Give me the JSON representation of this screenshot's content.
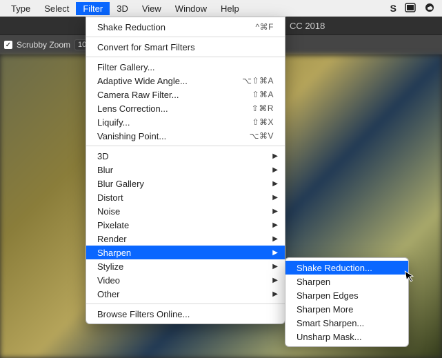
{
  "menubar": {
    "items": [
      "Type",
      "Select",
      "Filter",
      "3D",
      "View",
      "Window",
      "Help"
    ],
    "active_index": 2
  },
  "titlebar": {
    "app_suffix": "CC 2018"
  },
  "toolbar": {
    "scrubby_label": "Scrubby Zoom",
    "zoom_value": "10"
  },
  "dropdown": {
    "sections": [
      [
        {
          "label": "Shake Reduction",
          "shortcut": "^⌘F"
        }
      ],
      [
        {
          "label": "Convert for Smart Filters"
        }
      ],
      [
        {
          "label": "Filter Gallery..."
        },
        {
          "label": "Adaptive Wide Angle...",
          "shortcut": "⌥⇧⌘A"
        },
        {
          "label": "Camera Raw Filter...",
          "shortcut": "⇧⌘A"
        },
        {
          "label": "Lens Correction...",
          "shortcut": "⇧⌘R"
        },
        {
          "label": "Liquify...",
          "shortcut": "⇧⌘X"
        },
        {
          "label": "Vanishing Point...",
          "shortcut": "⌥⌘V"
        }
      ],
      [
        {
          "label": "3D",
          "submenu": true
        },
        {
          "label": "Blur",
          "submenu": true
        },
        {
          "label": "Blur Gallery",
          "submenu": true
        },
        {
          "label": "Distort",
          "submenu": true
        },
        {
          "label": "Noise",
          "submenu": true
        },
        {
          "label": "Pixelate",
          "submenu": true
        },
        {
          "label": "Render",
          "submenu": true
        },
        {
          "label": "Sharpen",
          "submenu": true,
          "selected": true
        },
        {
          "label": "Stylize",
          "submenu": true
        },
        {
          "label": "Video",
          "submenu": true
        },
        {
          "label": "Other",
          "submenu": true
        }
      ],
      [
        {
          "label": "Browse Filters Online..."
        }
      ]
    ]
  },
  "submenu": {
    "items": [
      {
        "label": "Shake Reduction...",
        "selected": true
      },
      {
        "label": "Sharpen"
      },
      {
        "label": "Sharpen Edges"
      },
      {
        "label": "Sharpen More"
      },
      {
        "label": "Smart Sharpen..."
      },
      {
        "label": "Unsharp Mask..."
      }
    ]
  }
}
